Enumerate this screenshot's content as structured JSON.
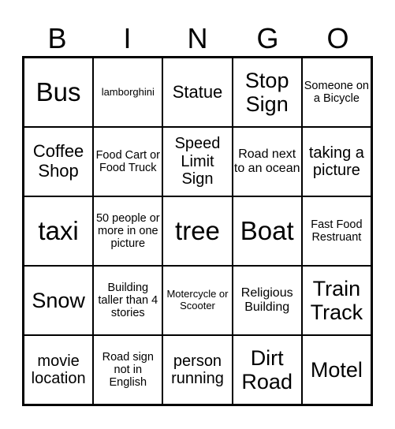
{
  "header": [
    "B",
    "I",
    "N",
    "G",
    "O"
  ],
  "cells": [
    {
      "text": "Bus",
      "size": "s-xl"
    },
    {
      "text": "lamborghini",
      "size": "s-xxs"
    },
    {
      "text": "Statue",
      "size": "s-m"
    },
    {
      "text": "Stop Sign",
      "size": "s-l"
    },
    {
      "text": "Someone on a Bicycle",
      "size": "s-xs"
    },
    {
      "text": "Coffee Shop",
      "size": "s-m"
    },
    {
      "text": "Food Cart or Food Truck",
      "size": "s-xs"
    },
    {
      "text": "Speed Limit Sign",
      "size": "s-ms"
    },
    {
      "text": "Road next to an ocean",
      "size": "s-s"
    },
    {
      "text": "taking a picture",
      "size": "s-ms"
    },
    {
      "text": "taxi",
      "size": "s-xl"
    },
    {
      "text": "50 people or more in one picture",
      "size": "s-xs"
    },
    {
      "text": "tree",
      "size": "s-xl"
    },
    {
      "text": "Boat",
      "size": "s-xl"
    },
    {
      "text": "Fast Food Restruant",
      "size": "s-xs"
    },
    {
      "text": "Snow",
      "size": "s-l"
    },
    {
      "text": "Building taller than 4 stories",
      "size": "s-xs"
    },
    {
      "text": "Motercycle or Scooter",
      "size": "s-xxs"
    },
    {
      "text": "Religious Building",
      "size": "s-s"
    },
    {
      "text": "Train Track",
      "size": "s-l"
    },
    {
      "text": "movie location",
      "size": "s-ms"
    },
    {
      "text": "Road sign not in English",
      "size": "s-xs"
    },
    {
      "text": "person running",
      "size": "s-ms"
    },
    {
      "text": "Dirt Road",
      "size": "s-l"
    },
    {
      "text": "Motel",
      "size": "s-l"
    }
  ]
}
